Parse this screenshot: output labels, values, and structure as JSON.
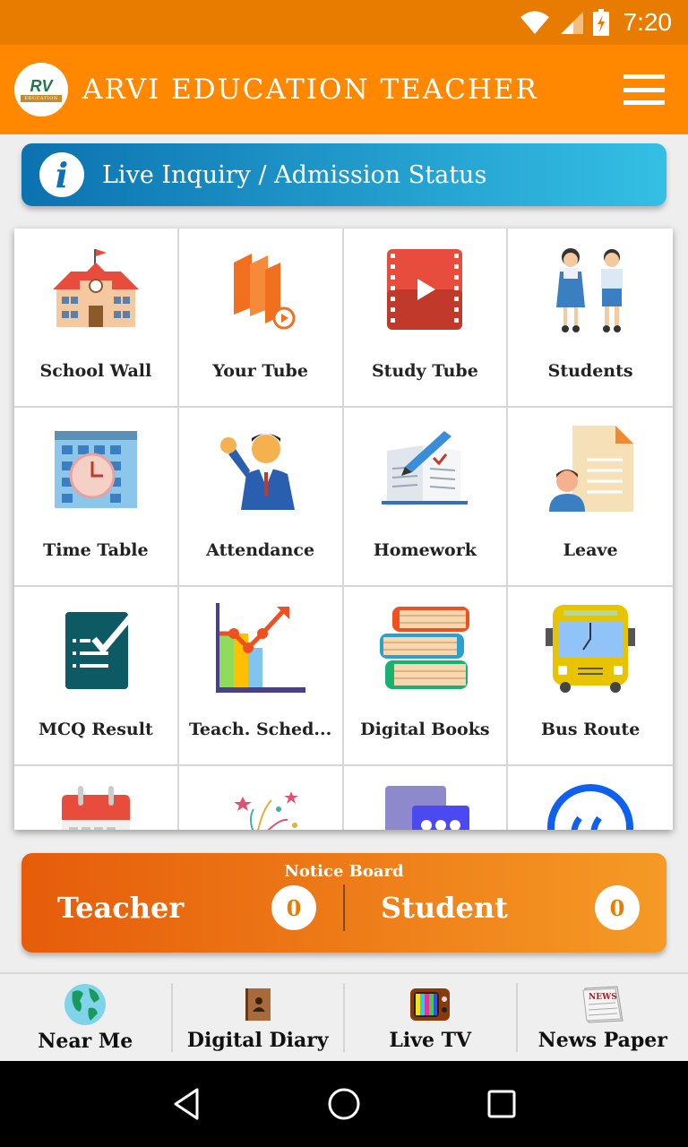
{
  "status_bar": {
    "time": "7:20",
    "icons": [
      "wifi-icon",
      "signal-icon",
      "battery-charging-icon"
    ]
  },
  "app_bar": {
    "title": "ARVI EDUCATION TEACHER",
    "logo_text": "RV",
    "logo_ribbon": "EDUCATION",
    "menu_icon": "hamburger-menu-icon"
  },
  "inquiry_banner": {
    "label": "Live Inquiry / Admission Status",
    "icon": "info-icon"
  },
  "grid": {
    "items": [
      {
        "label": "School Wall",
        "icon": "school-building-icon"
      },
      {
        "label": "Your Tube",
        "icon": "books-video-icon"
      },
      {
        "label": "Study Tube",
        "icon": "video-play-icon"
      },
      {
        "label": "Students",
        "icon": "students-icon"
      },
      {
        "label": "Time Table",
        "icon": "calendar-clock-icon"
      },
      {
        "label": "Attendance",
        "icon": "teacher-waving-icon"
      },
      {
        "label": "Homework",
        "icon": "notebook-pen-icon"
      },
      {
        "label": "Leave",
        "icon": "leave-document-icon"
      },
      {
        "label": "MCQ Result",
        "icon": "checklist-icon"
      },
      {
        "label": "Teach. Sched...",
        "icon": "growth-chart-icon"
      },
      {
        "label": "Digital Books",
        "icon": "book-stack-icon"
      },
      {
        "label": "Bus Route",
        "icon": "bus-icon"
      },
      {
        "label": "",
        "icon": "calendar-icon"
      },
      {
        "label": "",
        "icon": "party-popper-icon"
      },
      {
        "label": "",
        "icon": "chat-bubbles-icon"
      },
      {
        "label": "",
        "icon": "quote-icon"
      }
    ]
  },
  "notice_board": {
    "title": "Notice Board",
    "teacher_label": "Teacher",
    "teacher_count": "0",
    "student_label": "Student",
    "student_count": "0"
  },
  "bottom_nav": {
    "items": [
      {
        "label": "Near Me",
        "icon": "globe-icon"
      },
      {
        "label": "Digital Diary",
        "icon": "diary-icon"
      },
      {
        "label": "Live TV",
        "icon": "tv-icon"
      },
      {
        "label": "News Paper",
        "icon": "newspaper-icon"
      }
    ]
  },
  "system_nav": {
    "buttons": [
      "back-icon",
      "home-icon",
      "recents-icon"
    ]
  }
}
